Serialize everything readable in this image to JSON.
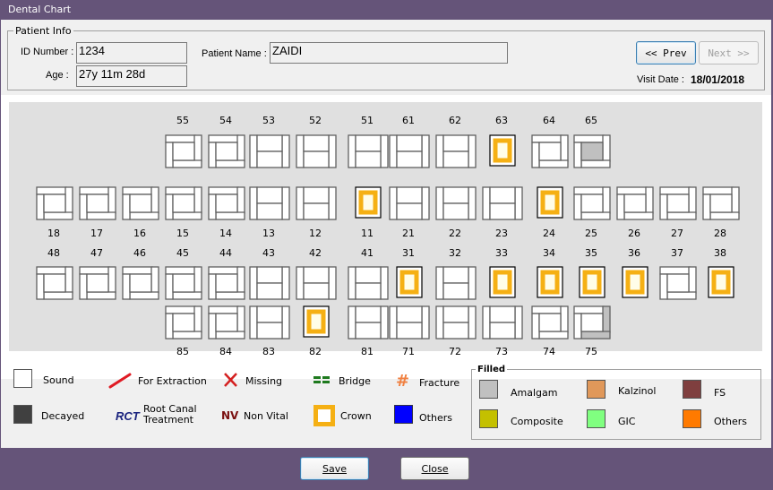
{
  "window": {
    "title": "Dental Chart"
  },
  "patient_info": {
    "legend": "Patient Info",
    "id_label": "ID Number :",
    "id_value": "1234",
    "age_label": "Age :",
    "age_value": "27y 11m 28d",
    "name_label": "Patient Name :",
    "name_value": "ZAIDI",
    "prev_label": "<< Prev",
    "next_label": "Next >>",
    "next_enabled": false,
    "visit_date_label": "Visit Date :",
    "visit_date_value": "18/01/2018"
  },
  "teeth": {
    "upper_primary": [
      {
        "num": "55",
        "col": 4,
        "type": "posterior",
        "state": "sound"
      },
      {
        "num": "54",
        "col": 5,
        "type": "posterior",
        "state": "sound"
      },
      {
        "num": "53",
        "col": 6,
        "type": "anterior",
        "state": "sound"
      },
      {
        "num": "52",
        "col": 7,
        "type": "anterior",
        "state": "sound"
      },
      {
        "num": "51",
        "col": 8,
        "type": "anterior",
        "state": "sound"
      },
      {
        "num": "61",
        "col": 9,
        "type": "anterior",
        "state": "sound"
      },
      {
        "num": "62",
        "col": 10,
        "type": "anterior",
        "state": "sound"
      },
      {
        "num": "63",
        "col": 11,
        "type": "anterior",
        "state": "crown"
      },
      {
        "num": "64",
        "col": 12,
        "type": "posterior",
        "state": "sound"
      },
      {
        "num": "65",
        "col": 13,
        "type": "posterior",
        "state": "amalgam-occlusal"
      }
    ],
    "upper_permanent": [
      {
        "num": "18",
        "col": 1,
        "type": "posterior",
        "state": "sound"
      },
      {
        "num": "17",
        "col": 2,
        "type": "posterior",
        "state": "sound"
      },
      {
        "num": "16",
        "col": 3,
        "type": "posterior",
        "state": "sound"
      },
      {
        "num": "15",
        "col": 4,
        "type": "posterior",
        "state": "sound"
      },
      {
        "num": "14",
        "col": 5,
        "type": "posterior",
        "state": "sound"
      },
      {
        "num": "13",
        "col": 6,
        "type": "anterior",
        "state": "sound"
      },
      {
        "num": "12",
        "col": 7,
        "type": "anterior",
        "state": "sound"
      },
      {
        "num": "11",
        "col": 8,
        "type": "anterior",
        "state": "crown"
      },
      {
        "num": "21",
        "col": 9,
        "type": "anterior",
        "state": "sound"
      },
      {
        "num": "22",
        "col": 10,
        "type": "anterior",
        "state": "sound"
      },
      {
        "num": "23",
        "col": 11,
        "type": "anterior",
        "state": "sound"
      },
      {
        "num": "24",
        "col": 12,
        "type": "posterior",
        "state": "crown"
      },
      {
        "num": "25",
        "col": 13,
        "type": "posterior",
        "state": "sound"
      },
      {
        "num": "26",
        "col": 14,
        "type": "posterior",
        "state": "sound"
      },
      {
        "num": "27",
        "col": 15,
        "type": "posterior",
        "state": "sound"
      },
      {
        "num": "28",
        "col": 16,
        "type": "posterior",
        "state": "sound"
      }
    ],
    "lower_permanent": [
      {
        "num": "48",
        "col": 1,
        "type": "posterior",
        "state": "sound"
      },
      {
        "num": "47",
        "col": 2,
        "type": "posterior",
        "state": "sound"
      },
      {
        "num": "46",
        "col": 3,
        "type": "posterior",
        "state": "sound"
      },
      {
        "num": "45",
        "col": 4,
        "type": "posterior",
        "state": "sound"
      },
      {
        "num": "44",
        "col": 5,
        "type": "posterior",
        "state": "sound"
      },
      {
        "num": "43",
        "col": 6,
        "type": "anterior",
        "state": "sound"
      },
      {
        "num": "42",
        "col": 7,
        "type": "anterior",
        "state": "sound"
      },
      {
        "num": "41",
        "col": 8,
        "type": "anterior",
        "state": "sound"
      },
      {
        "num": "31",
        "col": 9,
        "type": "anterior",
        "state": "crown"
      },
      {
        "num": "32",
        "col": 10,
        "type": "anterior",
        "state": "sound"
      },
      {
        "num": "33",
        "col": 11,
        "type": "anterior",
        "state": "crown"
      },
      {
        "num": "34",
        "col": 12,
        "type": "posterior",
        "state": "crown"
      },
      {
        "num": "35",
        "col": 13,
        "type": "posterior",
        "state": "crown"
      },
      {
        "num": "36",
        "col": 14,
        "type": "posterior",
        "state": "crown"
      },
      {
        "num": "37",
        "col": 15,
        "type": "posterior",
        "state": "sound"
      },
      {
        "num": "38",
        "col": 16,
        "type": "posterior",
        "state": "crown"
      }
    ],
    "lower_primary": [
      {
        "num": "85",
        "col": 4,
        "type": "posterior",
        "state": "sound"
      },
      {
        "num": "84",
        "col": 5,
        "type": "posterior",
        "state": "sound"
      },
      {
        "num": "83",
        "col": 6,
        "type": "anterior",
        "state": "sound"
      },
      {
        "num": "82",
        "col": 7,
        "type": "anterior",
        "state": "crown"
      },
      {
        "num": "81",
        "col": 8,
        "type": "anterior",
        "state": "sound"
      },
      {
        "num": "71",
        "col": 9,
        "type": "anterior",
        "state": "sound"
      },
      {
        "num": "72",
        "col": 10,
        "type": "anterior",
        "state": "sound"
      },
      {
        "num": "73",
        "col": 11,
        "type": "anterior",
        "state": "sound"
      },
      {
        "num": "74",
        "col": 12,
        "type": "posterior",
        "state": "sound"
      },
      {
        "num": "75",
        "col": 13,
        "type": "posterior",
        "state": "amalgam-distal-lingual"
      }
    ]
  },
  "legend": {
    "sound": "Sound",
    "decayed": "Decayed",
    "for_extraction": "For Extraction",
    "rct_symbol": "RCT",
    "rct_line1": "Root Canal",
    "rct_line2": "Treatment",
    "missing": "Missing",
    "nv_symbol": "NV",
    "non_vital": "Non Vital",
    "bridge": "Bridge",
    "crown": "Crown",
    "fracture_symbol": "#",
    "fracture": "Fracture",
    "others": "Others",
    "colors": {
      "sound": "#ffffff",
      "decayed": "#404040",
      "for_extraction": "#e01b24",
      "missing": "#d42020",
      "non_vital": "#7a1010",
      "rct": "#1a237e",
      "bridge": "#1e7a1e",
      "crown": "#f5b014",
      "fracture": "#f08040",
      "others": "#0000ff"
    }
  },
  "filled": {
    "legend": "Filled",
    "items": [
      {
        "label": "Amalgam",
        "color": "#c0c0c0"
      },
      {
        "label": "Kalzinol",
        "color": "#e0985a"
      },
      {
        "label": "FS",
        "color": "#7f3f3f"
      },
      {
        "label": "Composite",
        "color": "#c4c000"
      },
      {
        "label": "GIC",
        "color": "#80ff80"
      },
      {
        "label": "Others",
        "color": "#ff7a00"
      }
    ]
  },
  "footer": {
    "save_label": "Save",
    "close_label": "Close"
  }
}
